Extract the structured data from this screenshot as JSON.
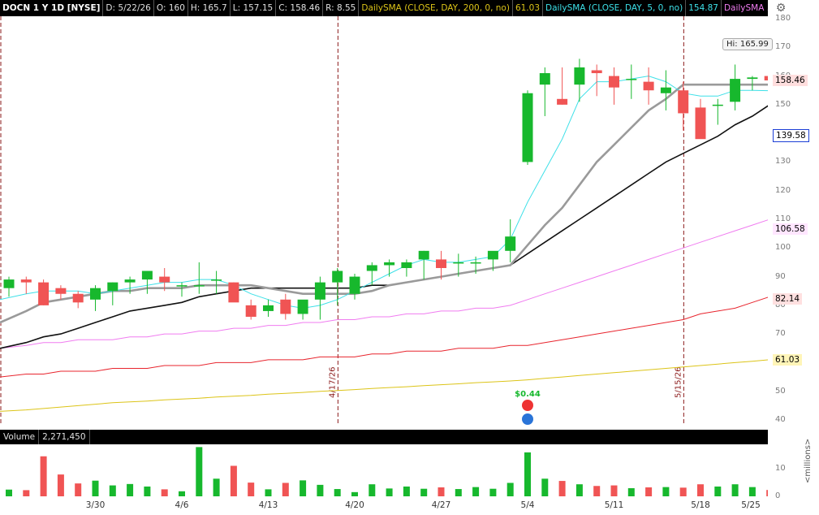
{
  "header": {
    "symbol": "DOCN 1 Y 1D [NYSE]",
    "date": "D: 5/22/26",
    "open": "O: 160",
    "high": "H: 165.7",
    "low": "L: 157.15",
    "close": "C: 158.46",
    "range": "R: 8.55",
    "sma200_label": "DailySMA (CLOSE, DAY, 200, 0, no)",
    "sma200_value": "61.03",
    "sma5_label": "DailySMA (CLOSE, DAY, 5, 0, no)",
    "sma5_value": "154.87",
    "sma_more_label": "DailySMA ..."
  },
  "colors": {
    "up": "#17b82d",
    "down": "#f05454",
    "sma5": "#3de0e8",
    "sma10": "#9a9a9a",
    "sma20": "#111111",
    "sma50": "#f07cf0",
    "sma100": "#e8252e",
    "sma200": "#dcc418"
  },
  "hi_label": "Hi: 165.99",
  "events": {
    "dividend_label": "$0.44",
    "event_markers": [
      "4/17/26",
      "5/15/26"
    ]
  },
  "volume_header": {
    "title": "Volume",
    "value": "2,271,450",
    "unit_label": "<millions>"
  },
  "chart_data": {
    "type": "candlestick",
    "x_dates": [
      "3/23",
      "3/24",
      "3/25",
      "3/26",
      "3/27",
      "3/30",
      "3/31",
      "4/1",
      "4/2",
      "4/3",
      "4/6",
      "4/7",
      "4/8",
      "4/9",
      "4/10",
      "4/13",
      "4/14",
      "4/15",
      "4/16",
      "4/17",
      "4/20",
      "4/21",
      "4/22",
      "4/23",
      "4/24",
      "4/27",
      "4/28",
      "4/29",
      "4/30",
      "5/1",
      "5/4",
      "5/5",
      "5/6",
      "5/7",
      "5/8",
      "5/11",
      "5/12",
      "5/13",
      "5/14",
      "5/15",
      "5/18",
      "5/19",
      "5/20",
      "5/21",
      "5/22"
    ],
    "open": [
      86,
      89,
      88,
      86,
      84,
      82,
      85,
      88,
      89,
      90,
      87,
      87,
      89,
      88,
      80,
      78,
      82,
      77,
      82,
      88,
      84,
      92,
      94,
      93,
      96,
      96,
      95,
      95,
      96,
      99,
      130,
      157,
      152,
      157,
      162,
      160,
      159,
      158,
      154,
      155,
      149,
      150,
      151,
      159,
      160
    ],
    "high": [
      90,
      90,
      89,
      87,
      85,
      87,
      88,
      90,
      92,
      93,
      88,
      95,
      92,
      88,
      82,
      82,
      84,
      79,
      90,
      93,
      91,
      95,
      96,
      96,
      99,
      99,
      98,
      97,
      98,
      110,
      155,
      163,
      163,
      166,
      164,
      163,
      164,
      163,
      162,
      158,
      152,
      152,
      164,
      160,
      165.7
    ],
    "low": [
      83,
      84,
      80,
      82,
      79,
      78,
      80,
      84,
      84,
      85,
      83,
      84,
      84,
      83,
      75,
      76,
      75,
      75,
      75,
      80,
      82,
      87,
      90,
      90,
      89,
      89,
      90,
      91,
      92,
      95,
      129,
      146,
      150,
      151,
      153,
      150,
      152,
      150,
      148,
      141,
      140,
      143,
      148,
      155,
      157.15
    ],
    "close": [
      89,
      88,
      80,
      84,
      81,
      86,
      88,
      89,
      92,
      88,
      87,
      87,
      89,
      81,
      76,
      80,
      77,
      82,
      88,
      92,
      90,
      94,
      95,
      95,
      99,
      93,
      95,
      95,
      99,
      104,
      154,
      161,
      150,
      163,
      161,
      156,
      159,
      155,
      156,
      147,
      138,
      150,
      159,
      159.5,
      158.46
    ],
    "volume": [
      2.4,
      2.2,
      14.3,
      7.8,
      4.6,
      5.6,
      3.9,
      4.4,
      3.5,
      2.5,
      1.8,
      17.6,
      6.3,
      10.9,
      4.9,
      2.5,
      4.8,
      5.7,
      4.1,
      2.6,
      1.5,
      4.3,
      2.8,
      3.5,
      2.7,
      3.2,
      2.6,
      3.3,
      2.7,
      4.8,
      15.7,
      6.3,
      5.5,
      4.3,
      3.7,
      3.9,
      2.9,
      3.2,
      3.3,
      3.1,
      4.3,
      3.5,
      4.3,
      3.3,
      2.27
    ],
    "sma5": [
      82,
      84,
      85,
      85,
      85,
      84,
      85,
      86,
      87,
      88,
      88,
      89,
      89,
      87,
      84,
      82,
      80,
      79,
      80,
      82,
      85,
      88,
      91,
      94,
      96,
      95,
      95,
      96,
      97,
      103,
      116,
      127,
      138,
      152,
      158,
      158,
      159,
      160,
      158,
      154,
      153,
      153,
      155,
      155,
      154.87
    ],
    "sma10": [
      74,
      78,
      81,
      82,
      83,
      84,
      85,
      85,
      86,
      86,
      86,
      87,
      87,
      87,
      87,
      86,
      85,
      84,
      84,
      84,
      84,
      85,
      87,
      88,
      89,
      90,
      91,
      92,
      93,
      94,
      101,
      108,
      114,
      122,
      130,
      136,
      142,
      148,
      152,
      157,
      157,
      157,
      157,
      157,
      157
    ],
    "sma20": [
      65,
      67,
      69,
      70,
      72,
      74,
      76,
      78,
      79,
      80,
      81,
      83,
      84,
      85,
      86,
      86,
      86,
      86,
      86,
      86,
      86,
      87,
      87,
      88,
      89,
      90,
      91,
      92,
      93,
      94,
      98,
      102,
      106,
      110,
      114,
      118,
      122,
      126,
      130,
      133,
      136,
      139,
      143,
      146,
      150
    ],
    "sma50": [
      65,
      66,
      67,
      67,
      68,
      68,
      68,
      69,
      69,
      70,
      70,
      71,
      71,
      72,
      72,
      73,
      73,
      74,
      74,
      75,
      75,
      76,
      76,
      77,
      77,
      78,
      78,
      79,
      79,
      80,
      82,
      84,
      86,
      88,
      90,
      92,
      94,
      96,
      98,
      100,
      102,
      104,
      106,
      108,
      110
    ],
    "sma100": [
      55,
      56,
      56,
      57,
      57,
      57,
      58,
      58,
      58,
      59,
      59,
      59,
      60,
      60,
      60,
      61,
      61,
      61,
      62,
      62,
      62,
      63,
      63,
      64,
      64,
      64,
      65,
      65,
      65,
      66,
      66,
      67,
      68,
      69,
      70,
      71,
      72,
      73,
      74,
      75,
      77,
      78,
      79,
      81,
      83
    ],
    "sma200": [
      43,
      43.5,
      44,
      44.5,
      45,
      45.5,
      46,
      46.3,
      46.6,
      47,
      47.3,
      47.6,
      48,
      48.3,
      48.6,
      49,
      49.3,
      49.6,
      50,
      50.3,
      50.6,
      51,
      51.3,
      51.6,
      52,
      52.3,
      52.6,
      53,
      53.3,
      53.6,
      54,
      54.5,
      55,
      55.5,
      56,
      56.5,
      57,
      57.5,
      58,
      58.5,
      59,
      59.5,
      60,
      60.5,
      61.03
    ],
    "y_ticks": [
      40,
      50,
      60,
      70,
      80,
      90,
      100,
      110,
      120,
      130,
      140,
      150,
      160,
      170,
      180
    ],
    "ylim": [
      40,
      180
    ],
    "volume_ticks": [
      0,
      10
    ],
    "volume_ylim": [
      0,
      18
    ],
    "x_tick_labels": [
      "3/30",
      "4/6",
      "4/13",
      "4/20",
      "4/27",
      "5/4",
      "5/11",
      "5/18",
      "5/25"
    ],
    "price_labels": [
      {
        "text": "158.46",
        "value": 158.46,
        "color": "#f05454",
        "bg": "#ffdede"
      },
      {
        "text": "139.58",
        "value": 139.58,
        "color": "#1c3fd6",
        "bg": "#ffffff",
        "border": "#1c3fd6"
      },
      {
        "text": "106.58",
        "value": 106.58,
        "color": "#f07cf0",
        "bg": "#ffe6ff"
      },
      {
        "text": "82.14",
        "value": 82.14,
        "color": "#e8252e",
        "bg": "#ffe0e0"
      },
      {
        "text": "61.03",
        "value": 61.03,
        "color": "#dcc418",
        "bg": "#fff5b8"
      }
    ]
  }
}
